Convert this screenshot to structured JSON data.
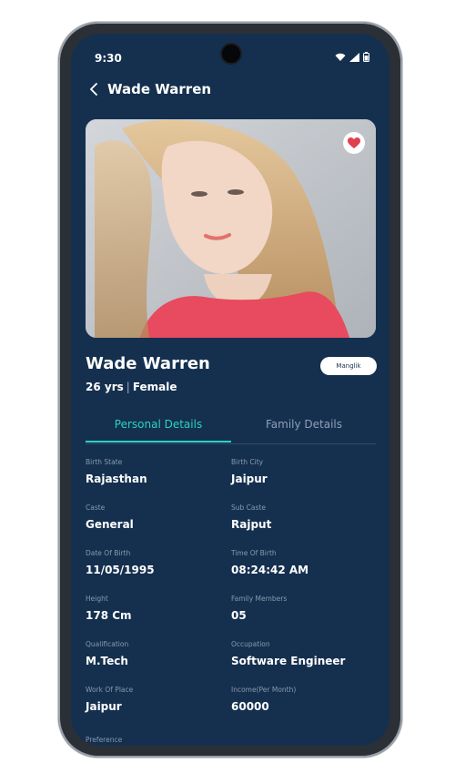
{
  "status_bar": {
    "time": "9:30",
    "icons": [
      "wifi-icon",
      "signal-icon",
      "battery-icon"
    ]
  },
  "header": {
    "back_icon": "chevron-left-icon",
    "title": "Wade Warren"
  },
  "profile": {
    "photo_icon": "profile-photo",
    "favorite_icon": "heart-icon",
    "name": "Wade Warren",
    "age": "26 yrs",
    "separator": "|",
    "gender": "Female",
    "badge": "Manglik"
  },
  "tabs": [
    {
      "label": "Personal Details",
      "active": true
    },
    {
      "label": "Family Details",
      "active": false
    }
  ],
  "details": [
    {
      "left": {
        "label": "Birth State",
        "value": "Rajasthan"
      },
      "right": {
        "label": "Birth City",
        "value": "Jaipur"
      }
    },
    {
      "left": {
        "label": "Caste",
        "value": "General"
      },
      "right": {
        "label": "Sub Caste",
        "value": "Rajput"
      }
    },
    {
      "left": {
        "label": "Date Of Birth",
        "value": "11/05/1995"
      },
      "right": {
        "label": "Time Of Birth",
        "value": "08:24:42 AM"
      }
    },
    {
      "left": {
        "label": "Height",
        "value": "178 Cm"
      },
      "right": {
        "label": "Family Members",
        "value": "05"
      }
    },
    {
      "left": {
        "label": "Qualification",
        "value": "M.Tech"
      },
      "right": {
        "label": "Occupation",
        "value": "Software Engineer"
      }
    },
    {
      "left": {
        "label": "Work Of Place",
        "value": "Jaipur"
      },
      "right": {
        "label": "Income(Per Month)",
        "value": "60000"
      }
    }
  ],
  "preference_label": "Preference",
  "colors": {
    "background": "#15304f",
    "accent": "#2ad3c0",
    "favorite": "#e0414f"
  }
}
